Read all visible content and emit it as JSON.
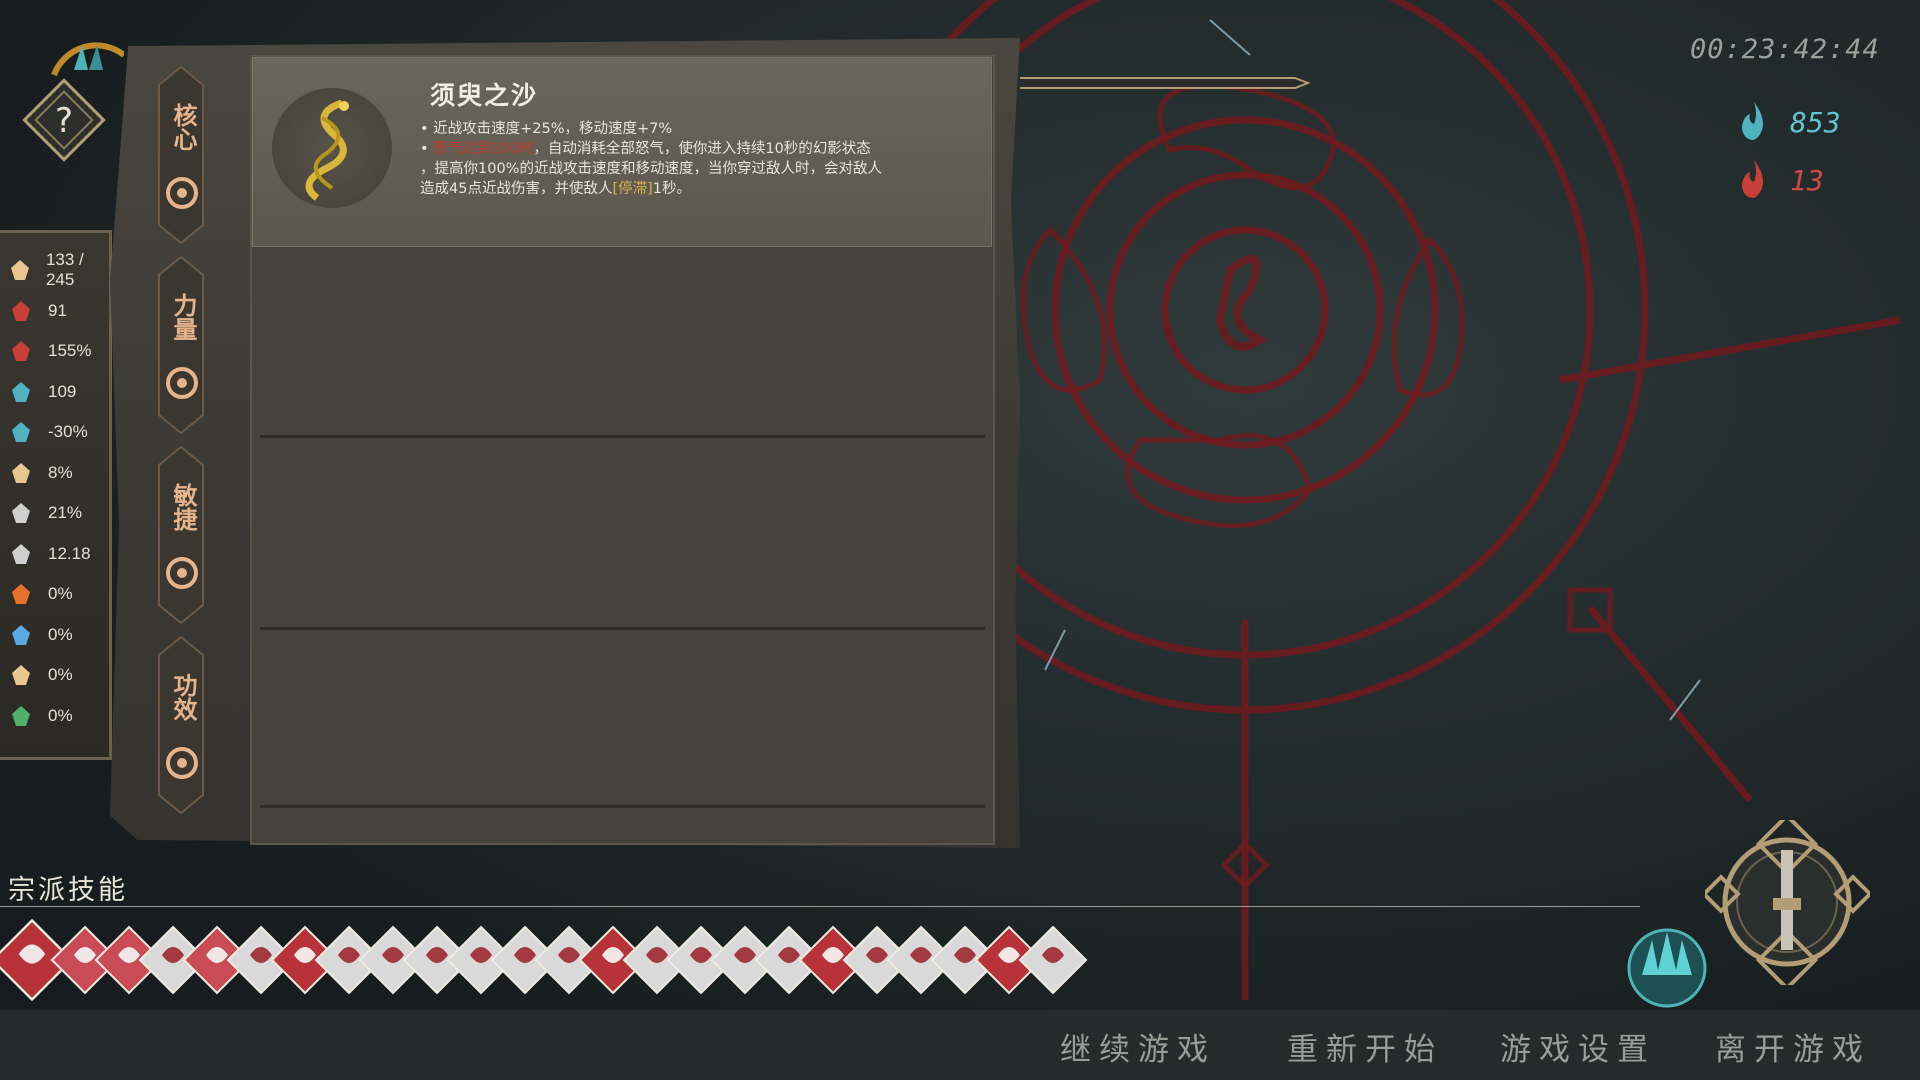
{
  "timer": "00:23:42:44",
  "resources": {
    "soul_value": "853",
    "blood_value": "13"
  },
  "stats": [
    {
      "icon": "heart-icon",
      "value": "133 / 245"
    },
    {
      "icon": "claw-attack-icon",
      "value": "91"
    },
    {
      "icon": "attack-speed-icon",
      "value": "155%"
    },
    {
      "icon": "ranged-attack-icon",
      "value": "109"
    },
    {
      "icon": "ranged-speed-icon",
      "value": "-30%"
    },
    {
      "icon": "crit-icon",
      "value": "8%"
    },
    {
      "icon": "shield-icon",
      "value": "21%"
    },
    {
      "icon": "boot-speed-icon",
      "value": "12.18"
    },
    {
      "icon": "fire-icon",
      "value": "0%"
    },
    {
      "icon": "frost-icon",
      "value": "0%"
    },
    {
      "icon": "lightning-icon",
      "value": "0%"
    },
    {
      "icon": "poison-icon",
      "value": "0%"
    }
  ],
  "categories": [
    {
      "label": "核心",
      "icon": "swirl-icon"
    },
    {
      "label": "力量",
      "icon": "fist-icon"
    },
    {
      "label": "敏捷",
      "icon": "running-icon"
    },
    {
      "label": "功效",
      "icon": "leaf-icon"
    }
  ],
  "skill": {
    "title": "须臾之沙",
    "line1": "• 近战攻击速度+25%，移动速度+7%",
    "line2_bullet": "• ",
    "line2_red": "怒气达到100时",
    "line2_rest": "，自动消耗全部怒气，使你进入持续10秒的幻影状态",
    "line3": "，提高你100%的近战攻击速度和移动速度，当你穿过敌人时，会对敌人",
    "line4_pre": "造成45点近战伤害，并使敌人",
    "line4_yellow": "[停滞]",
    "line4_post": "1秒。"
  },
  "sect": {
    "title": "宗派技能"
  },
  "menu": {
    "continue": "继续游戏",
    "restart": "重新开始",
    "settings": "游戏设置",
    "quit": "离开游戏"
  },
  "colors": {
    "accent_orange": "#e7b38a",
    "soul_cyan": "#5fc6cf",
    "blood_red": "#d24a45",
    "seal_red": "#7a1a1e"
  }
}
